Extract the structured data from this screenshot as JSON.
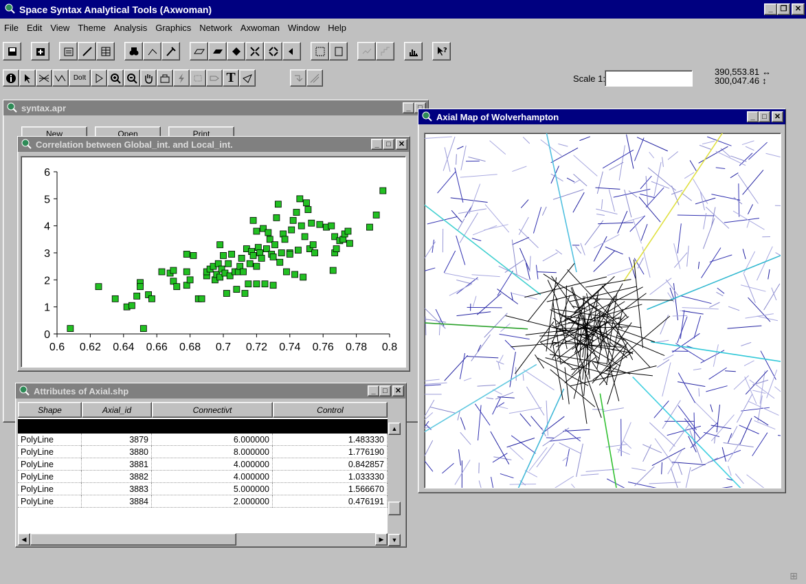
{
  "app": {
    "title": "Space Syntax Analytical Tools (Axwoman)"
  },
  "menu": [
    "File",
    "Edit",
    "View",
    "Theme",
    "Analysis",
    "Graphics",
    "Network",
    "Axwoman",
    "Window",
    "Help"
  ],
  "toolbar2": {
    "scale_label": "Scale 1:",
    "scale_value": "",
    "coord_x": "390,553.81",
    "coord_y": "300,047.46"
  },
  "windows": {
    "project": {
      "title": "syntax.apr",
      "btn_new": "New",
      "btn_open": "Open",
      "btn_print": "Print"
    },
    "chart": {
      "title": "Correlation between Global_int. and Local_int."
    },
    "map": {
      "title": "Axial Map of Wolverhampton"
    },
    "attributes": {
      "title": "Attributes of Axial.shp",
      "columns": [
        "Shape",
        "Axial_id",
        "Connectivt",
        "Control"
      ],
      "rows": [
        [
          "PolyLine",
          "3879",
          "6.000000",
          "1.483330"
        ],
        [
          "PolyLine",
          "3880",
          "8.000000",
          "1.776190"
        ],
        [
          "PolyLine",
          "3881",
          "4.000000",
          "0.842857"
        ],
        [
          "PolyLine",
          "3882",
          "4.000000",
          "1.033330"
        ],
        [
          "PolyLine",
          "3883",
          "5.000000",
          "1.566670"
        ],
        [
          "PolyLine",
          "3884",
          "2.000000",
          "0.476191"
        ]
      ]
    }
  },
  "chart_data": {
    "type": "scatter",
    "xlim": [
      0.6,
      0.8
    ],
    "ylim": [
      0,
      6
    ],
    "xticks": [
      "0.6",
      "0.62",
      "0.64",
      "0.66",
      "0.68",
      "0.7",
      "0.72",
      "0.74",
      "0.76",
      "0.78",
      "0.8"
    ],
    "yticks": [
      "0",
      "1",
      "2",
      "3",
      "4",
      "5",
      "6"
    ],
    "marker_color": "#22c022",
    "grid": false,
    "points": [
      [
        0.608,
        0.2
      ],
      [
        0.625,
        1.75
      ],
      [
        0.635,
        1.3
      ],
      [
        0.642,
        1.0
      ],
      [
        0.645,
        1.05
      ],
      [
        0.648,
        1.4
      ],
      [
        0.65,
        1.9
      ],
      [
        0.65,
        1.75
      ],
      [
        0.652,
        0.2
      ],
      [
        0.655,
        1.45
      ],
      [
        0.657,
        1.3
      ],
      [
        0.663,
        2.3
      ],
      [
        0.668,
        2.25
      ],
      [
        0.67,
        1.95
      ],
      [
        0.67,
        2.35
      ],
      [
        0.672,
        1.75
      ],
      [
        0.678,
        1.8
      ],
      [
        0.678,
        2.3
      ],
      [
        0.678,
        2.95
      ],
      [
        0.68,
        2.0
      ],
      [
        0.682,
        2.9
      ],
      [
        0.685,
        1.3
      ],
      [
        0.687,
        1.3
      ],
      [
        0.69,
        2.15
      ],
      [
        0.69,
        2.3
      ],
      [
        0.692,
        2.4
      ],
      [
        0.694,
        2.5
      ],
      [
        0.695,
        2.0
      ],
      [
        0.696,
        2.2
      ],
      [
        0.697,
        2.6
      ],
      [
        0.698,
        3.3
      ],
      [
        0.698,
        2.1
      ],
      [
        0.699,
        2.4
      ],
      [
        0.7,
        2.9
      ],
      [
        0.701,
        2.25
      ],
      [
        0.702,
        1.5
      ],
      [
        0.703,
        2.6
      ],
      [
        0.704,
        2.15
      ],
      [
        0.705,
        2.95
      ],
      [
        0.707,
        2.3
      ],
      [
        0.708,
        1.65
      ],
      [
        0.709,
        2.3
      ],
      [
        0.71,
        2.5
      ],
      [
        0.711,
        2.8
      ],
      [
        0.712,
        2.3
      ],
      [
        0.713,
        1.5
      ],
      [
        0.714,
        3.15
      ],
      [
        0.715,
        1.85
      ],
      [
        0.716,
        2.6
      ],
      [
        0.717,
        3.05
      ],
      [
        0.718,
        2.9
      ],
      [
        0.718,
        4.2
      ],
      [
        0.72,
        1.85
      ],
      [
        0.72,
        3.8
      ],
      [
        0.72,
        2.5
      ],
      [
        0.721,
        3.2
      ],
      [
        0.722,
        3.0
      ],
      [
        0.723,
        2.8
      ],
      [
        0.724,
        3.9
      ],
      [
        0.725,
        1.85
      ],
      [
        0.726,
        3.15
      ],
      [
        0.727,
        3.75
      ],
      [
        0.728,
        3.5
      ],
      [
        0.729,
        2.95
      ],
      [
        0.73,
        1.8
      ],
      [
        0.73,
        2.85
      ],
      [
        0.731,
        3.3
      ],
      [
        0.732,
        4.3
      ],
      [
        0.733,
        4.8
      ],
      [
        0.734,
        2.65
      ],
      [
        0.735,
        3.0
      ],
      [
        0.736,
        3.7
      ],
      [
        0.737,
        3.5
      ],
      [
        0.738,
        2.3
      ],
      [
        0.74,
        3.0
      ],
      [
        0.74,
        2.95
      ],
      [
        0.741,
        3.85
      ],
      [
        0.742,
        4.2
      ],
      [
        0.743,
        2.2
      ],
      [
        0.744,
        4.5
      ],
      [
        0.745,
        3.1
      ],
      [
        0.746,
        5.0
      ],
      [
        0.747,
        4.0
      ],
      [
        0.748,
        2.1
      ],
      [
        0.749,
        3.6
      ],
      [
        0.75,
        4.85
      ],
      [
        0.751,
        4.6
      ],
      [
        0.752,
        3.15
      ],
      [
        0.753,
        4.1
      ],
      [
        0.754,
        3.3
      ],
      [
        0.755,
        3.0
      ],
      [
        0.758,
        4.05
      ],
      [
        0.762,
        3.95
      ],
      [
        0.765,
        4.0
      ],
      [
        0.766,
        2.35
      ],
      [
        0.767,
        3.6
      ],
      [
        0.767,
        3.0
      ],
      [
        0.768,
        3.15
      ],
      [
        0.77,
        3.45
      ],
      [
        0.772,
        3.5
      ],
      [
        0.773,
        3.7
      ],
      [
        0.775,
        3.8
      ],
      [
        0.776,
        3.35
      ],
      [
        0.788,
        3.95
      ],
      [
        0.792,
        4.4
      ],
      [
        0.796,
        5.3
      ]
    ]
  }
}
